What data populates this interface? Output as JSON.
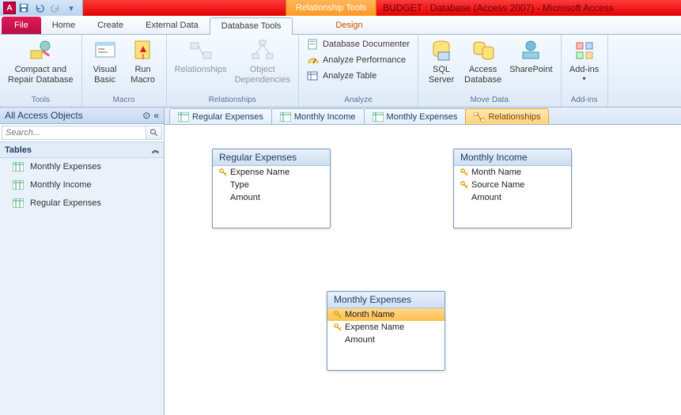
{
  "titlebar": {
    "context_tool": "Relationship Tools",
    "window_title": "BUDGET : Database (Access 2007) - Microsoft Access"
  },
  "tabs": {
    "file": "File",
    "home": "Home",
    "create": "Create",
    "external": "External Data",
    "dbtools": "Database Tools",
    "design": "Design"
  },
  "ribbon": {
    "tools": {
      "compact": "Compact and\nRepair Database",
      "label": "Tools"
    },
    "macro": {
      "vb": "Visual\nBasic",
      "run": "Run\nMacro",
      "label": "Macro"
    },
    "rel": {
      "rel": "Relationships",
      "dep": "Object\nDependencies",
      "label": "Relationships"
    },
    "analyze": {
      "doc": "Database Documenter",
      "perf": "Analyze Performance",
      "table": "Analyze Table",
      "label": "Analyze"
    },
    "move": {
      "sql": "SQL\nServer",
      "access": "Access\nDatabase",
      "sp": "SharePoint",
      "label": "Move Data"
    },
    "addins": {
      "btn": "Add-ins",
      "label": "Add-ins"
    }
  },
  "nav": {
    "header": "All Access Objects",
    "search_placeholder": "Search...",
    "category": "Tables",
    "items": [
      "Monthly Expenses",
      "Monthly Income",
      "Regular Expenses"
    ]
  },
  "doctabs": [
    "Regular Expenses",
    "Monthly Income",
    "Monthly Expenses",
    "Relationships"
  ],
  "tables": {
    "t1": {
      "title": "Regular Expenses",
      "fields": [
        {
          "name": "Expense Name",
          "key": true
        },
        {
          "name": "Type",
          "key": false
        },
        {
          "name": "Amount",
          "key": false
        }
      ]
    },
    "t2": {
      "title": "Monthly Income",
      "fields": [
        {
          "name": "Month Name",
          "key": true
        },
        {
          "name": "Source Name",
          "key": true
        },
        {
          "name": "Amount",
          "key": false
        }
      ]
    },
    "t3": {
      "title": "Monthly Expenses",
      "fields": [
        {
          "name": "Month Name",
          "key": true,
          "sel": true
        },
        {
          "name": "Expense Name",
          "key": true
        },
        {
          "name": "Amount",
          "key": false
        }
      ]
    }
  }
}
